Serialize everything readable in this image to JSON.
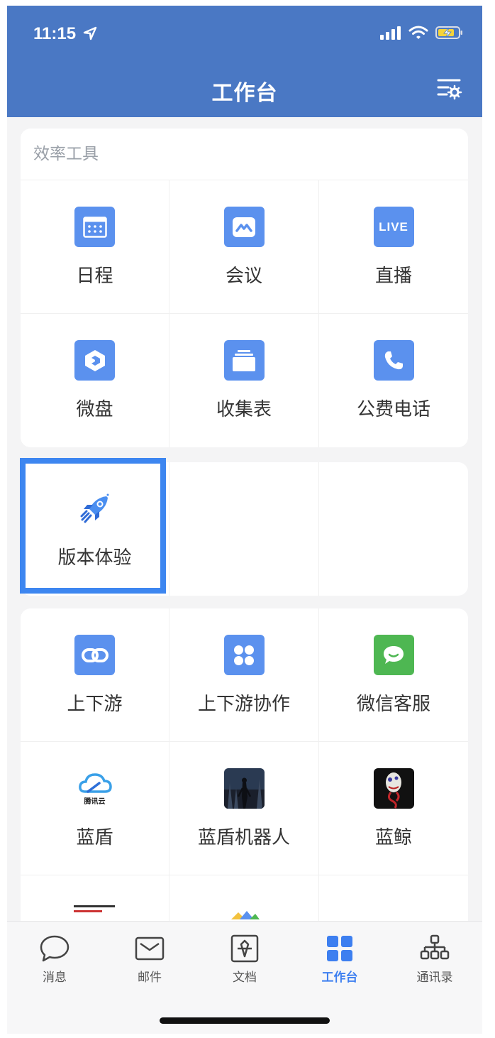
{
  "status": {
    "time": "11:15"
  },
  "header": {
    "title": "工作台"
  },
  "section1": {
    "title": "效率工具",
    "apps": [
      {
        "label": "日程",
        "icon": "calendar-icon"
      },
      {
        "label": "会议",
        "icon": "meeting-icon"
      },
      {
        "label": "直播",
        "icon": "live-icon",
        "icon_text": "LIVE"
      },
      {
        "label": "微盘",
        "icon": "drive-icon"
      },
      {
        "label": "收集表",
        "icon": "collect-form-icon"
      },
      {
        "label": "公费电话",
        "icon": "phone-icon"
      }
    ]
  },
  "section2": {
    "apps": [
      {
        "label": "版本体验",
        "icon": "rocket-icon"
      }
    ]
  },
  "section3": {
    "apps": [
      {
        "label": "上下游",
        "icon": "link-icon"
      },
      {
        "label": "上下游协作",
        "icon": "clover-icon"
      },
      {
        "label": "微信客服",
        "icon": "wechat-service-icon"
      },
      {
        "label": "蓝盾",
        "icon": "tencent-cloud-icon",
        "icon_text": "腾讯云"
      },
      {
        "label": "蓝盾机器人",
        "icon": "robot-thumbnail"
      },
      {
        "label": "蓝鲸",
        "icon": "whale-thumbnail"
      }
    ]
  },
  "tabbar": {
    "items": [
      {
        "label": "消息",
        "icon": "chat-bubble-icon"
      },
      {
        "label": "邮件",
        "icon": "mail-icon"
      },
      {
        "label": "文档",
        "icon": "document-icon"
      },
      {
        "label": "工作台",
        "icon": "workbench-icon",
        "active": true
      },
      {
        "label": "通讯录",
        "icon": "contacts-icon"
      }
    ]
  },
  "colors": {
    "header": "#4a78c4",
    "accent": "#3d7ff0",
    "icon_blue": "#5b91ee",
    "icon_green": "#4eb752"
  }
}
